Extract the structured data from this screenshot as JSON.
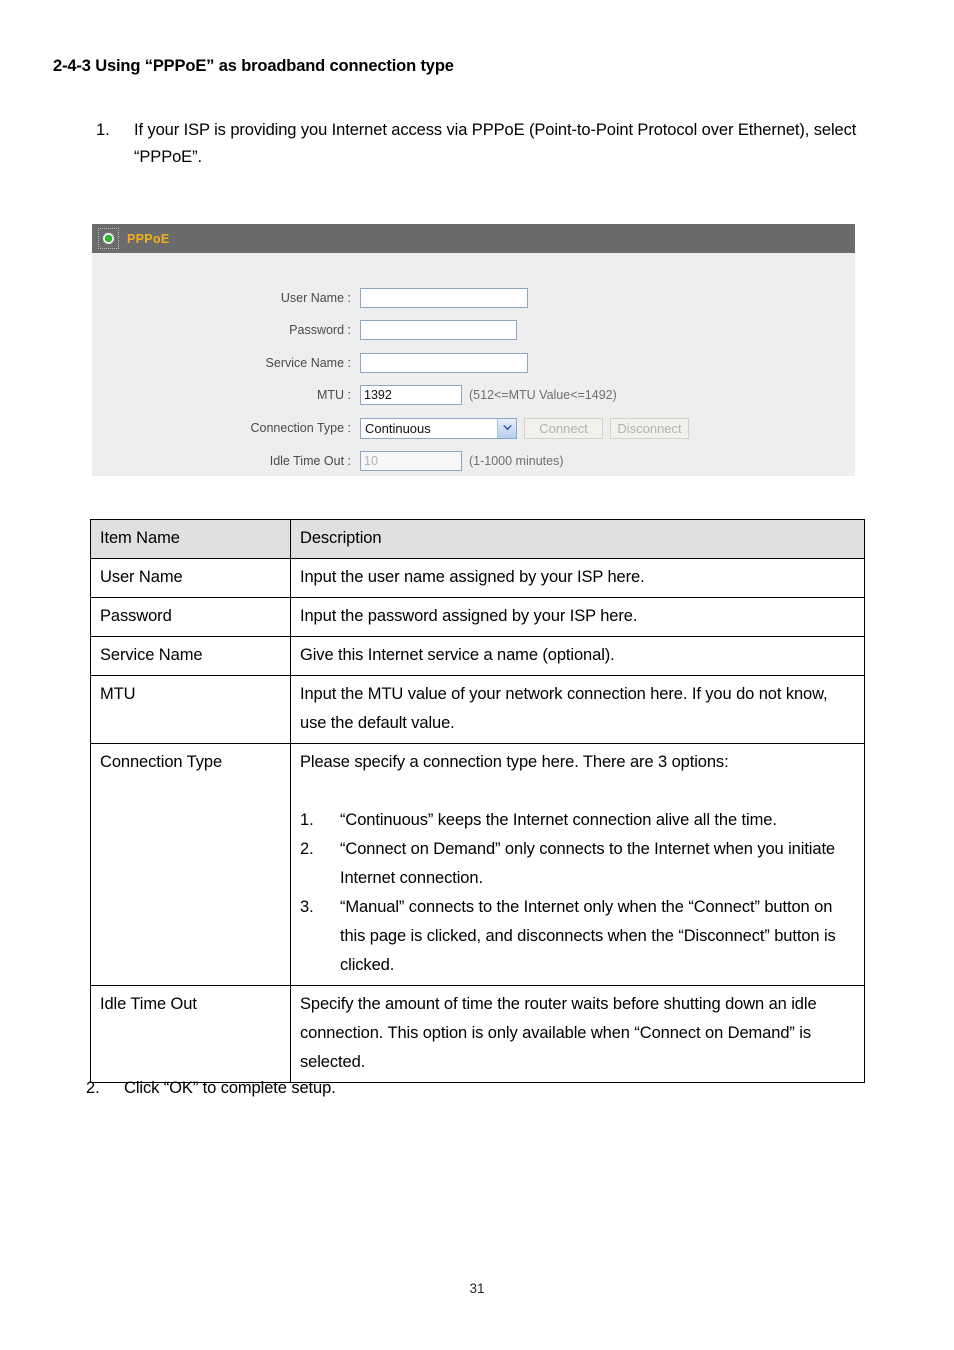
{
  "document": {
    "heading": "2-4-3 Using “PPPoE” as broadband connection type",
    "page_number": "31"
  },
  "steps": [
    {
      "number": "1.",
      "text": "If your ISP is providing you Internet access via PPPoE (Point-to-Point Protocol over Ethernet), select “PPPoE”."
    },
    {
      "number": "2.",
      "text": "Click “OK” to complete setup."
    }
  ],
  "panel": {
    "title": "PPPoE",
    "title_color": "#f2b11a",
    "header_bg": "#6b6b6b",
    "body_bg": "#eeeeee",
    "icon": "radio-selected-icon",
    "fields": [
      {
        "label": "User Name :",
        "value": "",
        "placeholder": "",
        "hint": "",
        "disabled": false
      },
      {
        "label": "Password :",
        "value": "",
        "placeholder": "",
        "hint": "",
        "disabled": false
      },
      {
        "label": "Service Name :",
        "value": "",
        "placeholder": "",
        "hint": "",
        "disabled": false
      },
      {
        "label": "MTU :",
        "value": "1392",
        "placeholder": "",
        "hint": "(512<=MTU Value<=1492)",
        "disabled": false
      },
      {
        "label": "Idle Time Out :",
        "value": "10",
        "placeholder": "10",
        "hint": "(1-1000 minutes)",
        "disabled": true
      }
    ],
    "connection_type": {
      "label": "Connection Type :",
      "selected": "Continuous",
      "options": [
        "Continuous",
        "Connect on Demand",
        "Manual"
      ],
      "connect_button": "Connect",
      "disconnect_button": "Disconnect",
      "buttons_disabled": true
    }
  },
  "table": {
    "headers": [
      "Item Name",
      "Description"
    ],
    "rows": [
      {
        "item": "User Name",
        "description": "Input the user name assigned by your ISP here."
      },
      {
        "item": "Password",
        "description": "Input the password assigned by your ISP here."
      },
      {
        "item": "Service Name",
        "description": "Give this Internet service a name (optional)."
      },
      {
        "item": "MTU",
        "description": "Input the MTU value of your network connection here. If you do not know, use the default value."
      },
      {
        "item": "Connection Type",
        "description": "Please specify a connection type here. There are 3 options:",
        "sub_items": [
          {
            "number": "1.",
            "text": "“Continuous” keeps the Internet connection alive all the time."
          },
          {
            "number": "2.",
            "text": "“Connect on Demand” only connects to the Internet when you initiate Internet connection."
          },
          {
            "number": "3.",
            "text": "“Manual” connects to the Internet only when the “Connect” button on this page is clicked, and disconnects when the “Disconnect” button is clicked."
          }
        ]
      },
      {
        "item": "Idle Time Out",
        "description": "Specify the amount of time the router waits before shutting down an idle connection. This option is only available when “Connect on Demand” is selected."
      }
    ]
  }
}
